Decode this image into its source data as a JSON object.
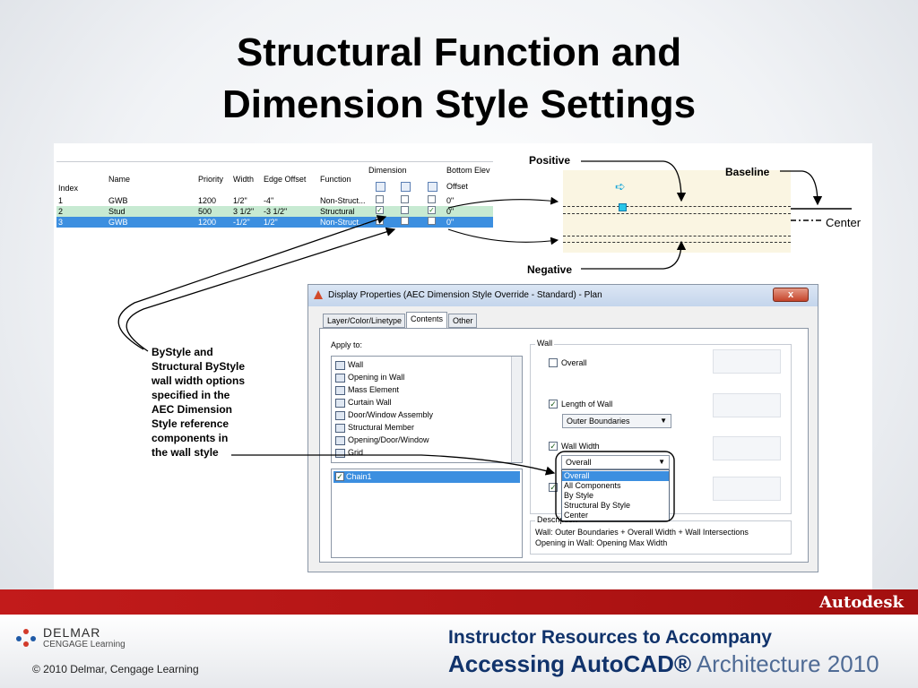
{
  "slide": {
    "title_line1": "Structural Function and",
    "title_line2": "Dimension Style Settings"
  },
  "table": {
    "headers": {
      "index": "Index",
      "name": "Name",
      "priority": "Priority",
      "width": "Width",
      "edge_offset": "Edge Offset",
      "function": "Function",
      "dimension": "Dimension",
      "bottom_elev": "Bottom Elev",
      "offset": "Offset"
    },
    "rows": [
      {
        "index": "1",
        "name": "GWB",
        "priority": "1200",
        "width": "1/2\"",
        "edge_offset": "-4\"",
        "function": "Non-Struct...",
        "offset": "0\""
      },
      {
        "index": "2",
        "name": "Stud",
        "priority": "500",
        "width": "3 1/2\"",
        "edge_offset": "-3 1/2\"",
        "function": "Structural",
        "offset": "0\""
      },
      {
        "index": "3",
        "name": "GWB",
        "priority": "1200",
        "width": "-1/2\"",
        "edge_offset": "1/2\"",
        "function": "Non-Struct...",
        "offset": "0\""
      }
    ]
  },
  "diagram": {
    "positive": "Positive",
    "baseline": "Baseline",
    "center": "Center",
    "negative": "Negative"
  },
  "dialog": {
    "title": "Display Properties (AEC Dimension Style Override - Standard) - Plan",
    "close": "x",
    "tabs": [
      "Layer/Color/Linetype",
      "Contents",
      "Other"
    ],
    "apply_to_label": "Apply to:",
    "apply_to_items": [
      "Wall",
      "Opening in Wall",
      "Mass Element",
      "Curtain Wall",
      "Door/Window Assembly",
      "Structural Member",
      "Opening/Door/Window",
      "Grid"
    ],
    "chain_item": "Chain1",
    "wall_group": "Wall",
    "overall_label": "Overall",
    "length_label": "Length of Wall",
    "length_combo": "Outer Boundaries",
    "width_label": "Wall Width",
    "width_combo": "Overall",
    "width_options": [
      "Overall",
      "All Components",
      "By Style",
      "Structural By Style",
      "Center"
    ],
    "description_label": "Description",
    "description_line1": "Wall: Outer Boundaries + Overall Width + Wall Intersections",
    "description_line2": "Opening in Wall: Opening Max Width"
  },
  "callout": {
    "lines": [
      "ByStyle and",
      "Structural ByStyle",
      "wall width options",
      "specified in the",
      "AEC Dimension",
      "Style reference",
      "components in",
      "the wall style"
    ]
  },
  "footer": {
    "autodesk": "Autodesk",
    "delmar": "DELMAR",
    "cengage": "CENGAGE Learning",
    "copyright": "© 2010 Delmar, Cengage Learning",
    "instructor": "Instructor Resources to Accompany",
    "accessing_bold": "Accessing AutoCAD®",
    "accessing_light": " Architecture 2010"
  },
  "colors": {
    "red_bar": "#c21b1b",
    "footer_text": "#11336b",
    "selection_blue": "#3c8fe0",
    "structural_row": "#c7ead2"
  }
}
